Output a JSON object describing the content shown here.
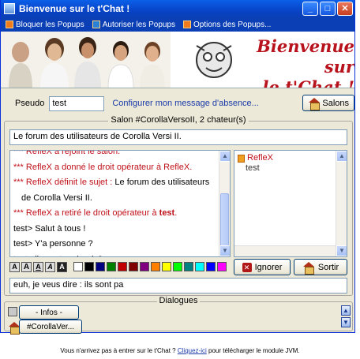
{
  "window": {
    "title": "Bienvenue sur le t'Chat !",
    "controls": {
      "minimize": "_",
      "maximize": "□",
      "close": "✕"
    }
  },
  "popup_bar": {
    "items": [
      {
        "label": "Bloquer les Popups",
        "icon": "block-popups-icon"
      },
      {
        "label": "Autoriser les Popups",
        "icon": "allow-popups-icon"
      },
      {
        "label": "Options des Popups...",
        "icon": "popup-options-icon"
      }
    ]
  },
  "banner": {
    "title": "Bienvenue sur\nle t'Chat !"
  },
  "user_bar": {
    "pseudo_label": "Pseudo",
    "pseudo_value": "test",
    "absence_link": "Configurer mon message d'absence...",
    "salons_label": "Salons"
  },
  "room": {
    "legend": "Salon #CorollaVersoII, 2 chateur(s)",
    "topic": "Le forum des utilisateurs de Corolla Versi II.",
    "messages": [
      {
        "prefix": "*** ",
        "text": "RefleX a rejoint le salon.",
        "kind": "sys"
      },
      {
        "prefix": "*** ",
        "text": "RefleX a donné le droit opérateur à RefleX.",
        "kind": "sys"
      },
      {
        "prefix": "*** ",
        "text": "RefleX définit le sujet : ",
        "extra": "Le forum des utilisateurs",
        "kind": "sys"
      },
      {
        "text": "de Corolla Versi II.",
        "kind": "cont"
      },
      {
        "prefix": "*** ",
        "text": "RefleX a retiré le droit opérateur à ",
        "bold": "test",
        "end": ".",
        "kind": "sys"
      },
      {
        "text": "test> Salut à tous !",
        "kind": "msg"
      },
      {
        "text": "test> Y'a personne ?",
        "kind": "msg"
      },
      {
        "text": "test> ils sont paris où ?",
        "kind": "msg"
      }
    ],
    "users": [
      {
        "name": "RefleX",
        "role": "op"
      },
      {
        "name": "test",
        "role": "reg"
      }
    ],
    "format_buttons": [
      "A",
      "A",
      "A",
      "A",
      "A"
    ],
    "colors": [
      "#ffffff",
      "#000000",
      "#000080",
      "#008000",
      "#c00000",
      "#800000",
      "#800080",
      "#ff8000",
      "#ffff00",
      "#00ff00",
      "#008080",
      "#00ffff",
      "#0000ff",
      "#ff00ff",
      "#808080",
      "#c0c0c0"
    ],
    "ignore_label": "Ignorer",
    "exit_label": "Sortir",
    "message_value": "euh, je veus dire : ils sont pa"
  },
  "dialogs": {
    "legend": "Dialogues",
    "infos_label": "- Infos -",
    "room_tab_label": "#CorollaVer..."
  },
  "footer": {
    "text_before": "Vous n'arrivez pas à entrer sur le t'Chat ?",
    "link": "Cliquez-ici",
    "text_after": "pour télécharger le module JVM."
  }
}
